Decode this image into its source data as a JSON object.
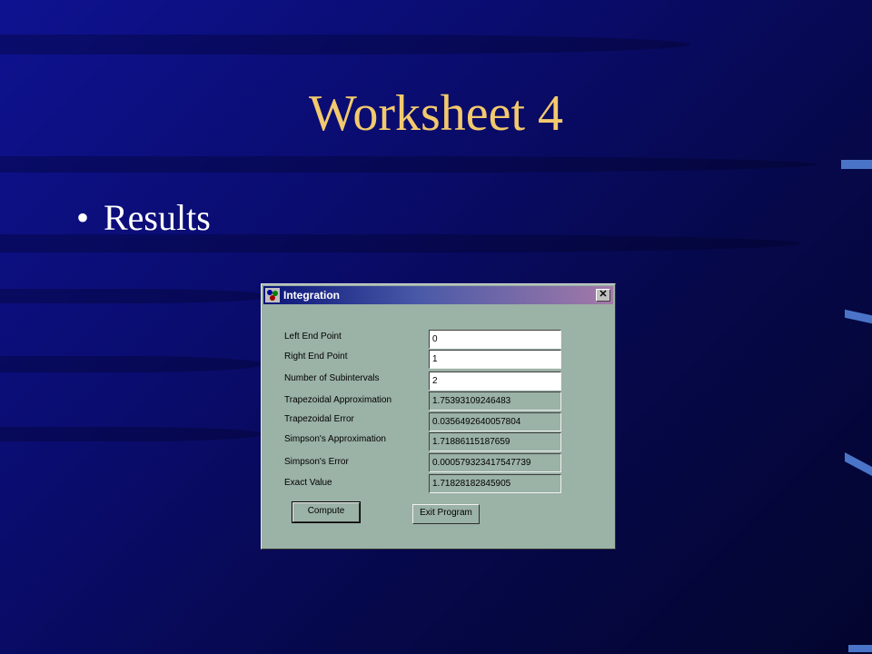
{
  "slide": {
    "title": "Worksheet 4",
    "bullet_char": "•",
    "bullet_text": "Results"
  },
  "dialog": {
    "title": "Integration",
    "icon": "integration-app-icon",
    "close_label": "✕",
    "fields": [
      {
        "label": "Left End Point",
        "value": "0",
        "editable": true
      },
      {
        "label": "Right End Point",
        "value": "1",
        "editable": true
      },
      {
        "label": "Number of Subintervals",
        "value": "2",
        "editable": true
      },
      {
        "label": "Trapezoidal Approximation",
        "value": "1.75393109246483",
        "editable": false
      },
      {
        "label": "Trapezoidal Error",
        "value": "0.0356492640057804",
        "editable": false
      },
      {
        "label": "Simpson's Approximation",
        "value": "1.71886115187659",
        "editable": false
      },
      {
        "label": "Simpson's Error",
        "value": "0.000579323417547739",
        "editable": false
      },
      {
        "label": "Exact Value",
        "value": "1.71828182845905",
        "editable": false
      }
    ],
    "compute_label": "Compute",
    "exit_label": "Exit Program"
  },
  "colors": {
    "title_text": "#f3c96d",
    "dialog_background": "#9bb2a6",
    "titlebar_start": "#0a1478",
    "titlebar_end": "#a47aa8",
    "slide_background": "#0a0c6e"
  }
}
